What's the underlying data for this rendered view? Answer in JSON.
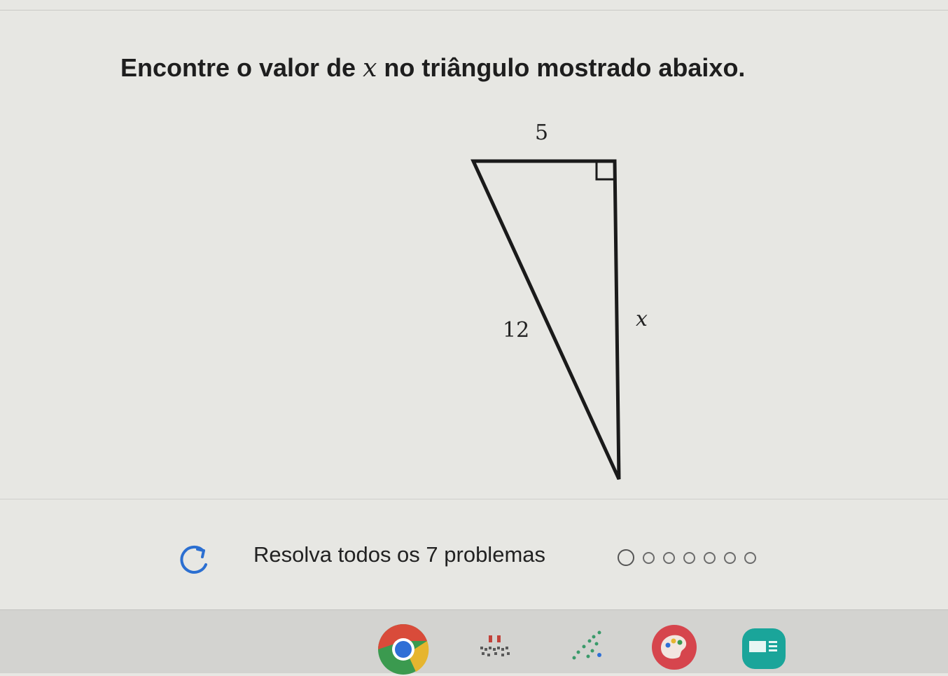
{
  "problem": {
    "prompt_before": "Encontre o valor de ",
    "variable": "x",
    "prompt_after": " no triângulo mostrado abaixo."
  },
  "triangle": {
    "top_side_label": "5",
    "hypotenuse_label": "12",
    "right_side_label": "x"
  },
  "footer": {
    "progress_label": "Resolva todos os 7 problemas",
    "problems_total": 7,
    "current_problem": 1
  },
  "taskbar": {
    "apps": [
      "chrome-icon",
      "game-app-icon",
      "graph-app-icon",
      "paint-app-icon",
      "slides-app-icon"
    ]
  },
  "colors": {
    "chrome_red": "#d94b3a",
    "chrome_yellow": "#e6b52f",
    "chrome_green": "#3b9a4f",
    "chrome_blue": "#2f6fd6",
    "paint_red": "#d6454d",
    "slides_teal": "#1aa59a"
  }
}
